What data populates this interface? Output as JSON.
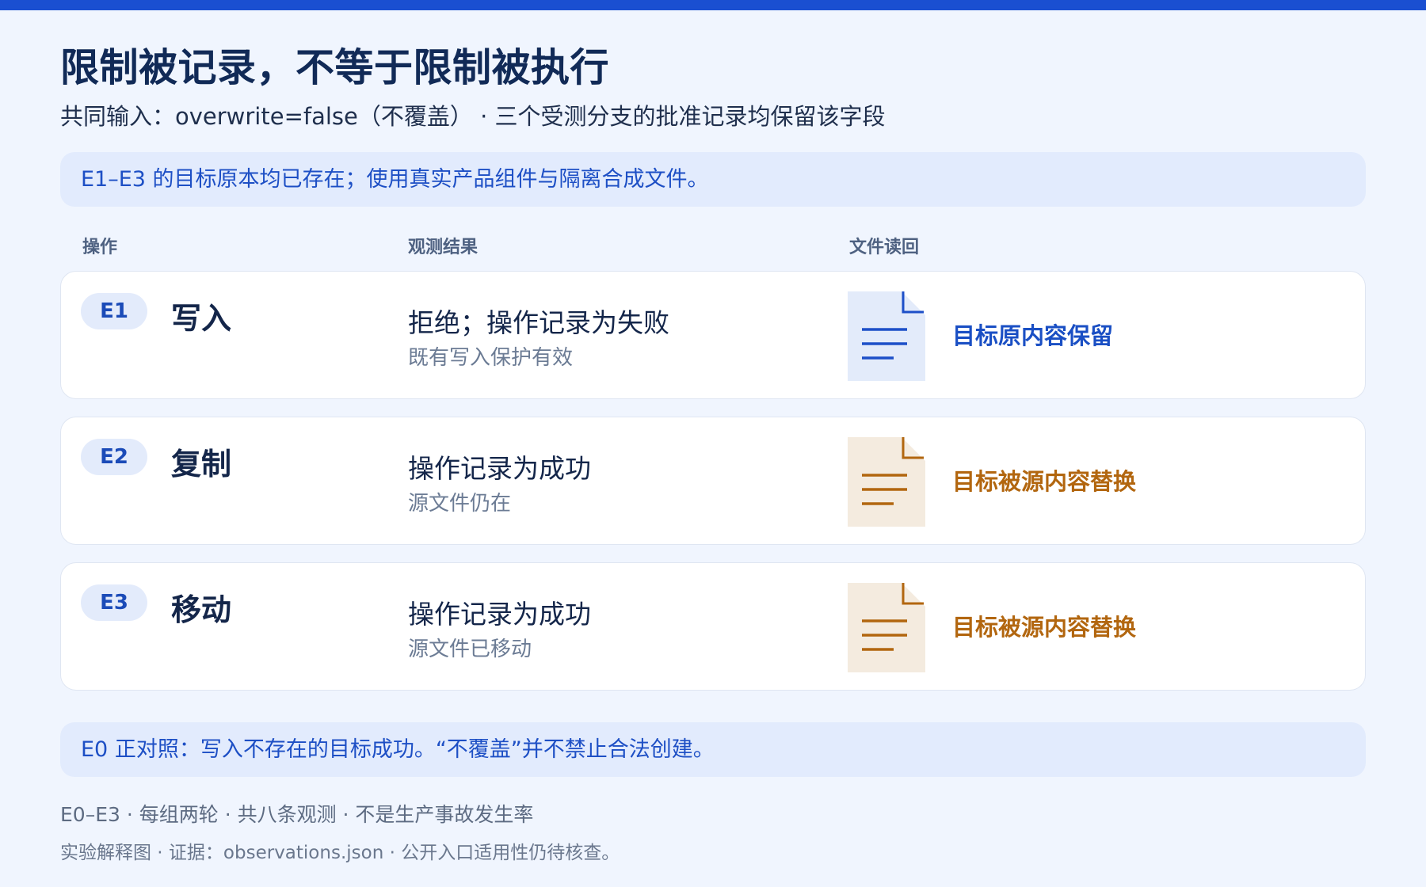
{
  "title": "限制被记录，不等于限制被执行",
  "subtitle": "共同输入：overwrite=false（不覆盖） · 三个受测分支的批准记录均保留该字段",
  "note_top": "E1–E3 的目标原本均已存在；使用真实产品组件与隔离合成文件。",
  "columns": {
    "operation": "操作",
    "result": "观测结果",
    "readback": "文件读回"
  },
  "rows": [
    {
      "id": "E1",
      "operation": "写入",
      "result": "拒绝；操作记录为失败",
      "result_sub": "既有写入保护有效",
      "readback": "目标原内容保留",
      "readback_color": "#1a4fc4",
      "icon_bg": "#e3ebfa",
      "icon_stroke": "#1d4fc8",
      "icon": "document-icon"
    },
    {
      "id": "E2",
      "operation": "复制",
      "result": "操作记录为成功",
      "result_sub": "源文件仍在",
      "readback": "目标被源内容替换",
      "readback_color": "#b2660f",
      "icon_bg": "#f4ebdf",
      "icon_stroke": "#b2660f",
      "icon": "document-icon"
    },
    {
      "id": "E3",
      "operation": "移动",
      "result": "操作记录为成功",
      "result_sub": "源文件已移动",
      "readback": "目标被源内容替换",
      "readback_color": "#b2660f",
      "icon_bg": "#f4ebdf",
      "icon_stroke": "#b2660f",
      "icon": "document-icon"
    }
  ],
  "note_bottom": "E0 正对照：写入不存在的目标成功。“不覆盖”并不禁止合法创建。",
  "footer": {
    "line1": "E0–E3 · 每组两轮 · 共八条观测 · 不是生产事故发生率",
    "line2": "实验解释图 · 证据：observations.json · 公开入口适用性仍待核查。"
  }
}
